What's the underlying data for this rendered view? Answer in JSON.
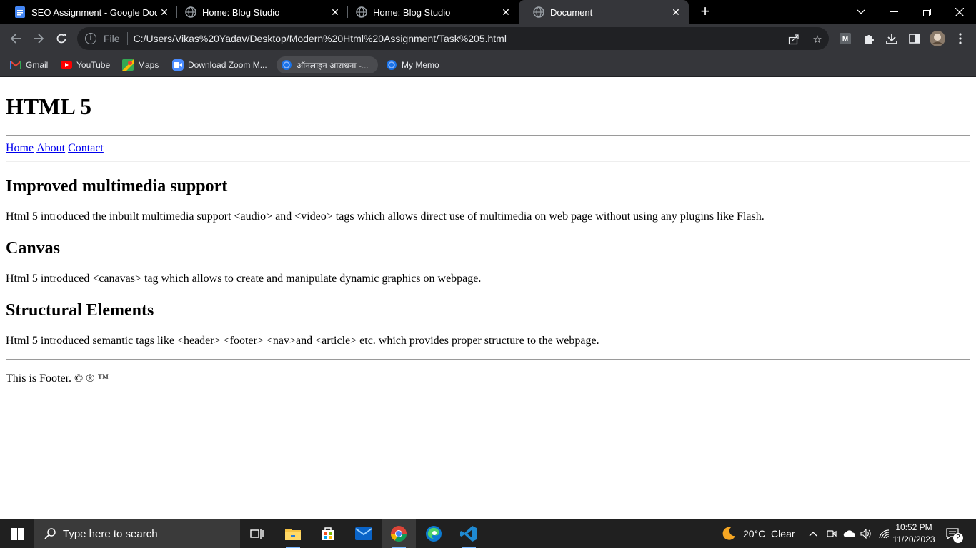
{
  "browser": {
    "tabs": [
      {
        "title": "SEO Assignment - Google Docs",
        "icon": "google-docs-icon"
      },
      {
        "title": "Home: Blog Studio",
        "icon": "globe-icon"
      },
      {
        "title": "Home: Blog Studio",
        "icon": "globe-icon"
      },
      {
        "title": "Document",
        "icon": "globe-icon",
        "active": true
      }
    ],
    "omnibox": {
      "scheme_label": "File",
      "url": "C:/Users/Vikas%20Yadav/Desktop/Modern%20Html%20Assignment/Task%205.html"
    },
    "bookmarks": [
      {
        "label": "Gmail",
        "icon": "gmail-icon"
      },
      {
        "label": "YouTube",
        "icon": "youtube-icon"
      },
      {
        "label": "Maps",
        "icon": "maps-icon"
      },
      {
        "label": "Download Zoom M...",
        "icon": "zoom-icon"
      },
      {
        "label": "ऑनलाइन आराधना -...",
        "icon": "globe-icon"
      },
      {
        "label": "My Memo",
        "icon": "globe-icon"
      }
    ]
  },
  "page": {
    "title": "HTML 5",
    "nav": [
      "Home",
      "About",
      "Contact"
    ],
    "sections": [
      {
        "heading": "Improved multimedia support",
        "text": "Html 5 introduced the inbuilt multimedia support <audio> and <video> tags which allows direct use of multimedia on web page without using any plugins like Flash."
      },
      {
        "heading": "Canvas",
        "text": "Html 5 introduced <canavas> tag which allows to create and manipulate dynamic graphics on webpage."
      },
      {
        "heading": "Structural Elements",
        "text": "Html 5 introduced semantic tags like <header> <footer> <nav>and <article> etc. which provides proper structure to the webpage."
      }
    ],
    "footer": "This is Footer. © ® ™"
  },
  "taskbar": {
    "search_placeholder": "Type here to search",
    "weather": "20°C  Clear",
    "time": "10:52 PM",
    "date": "11/20/2023",
    "notification_count": "2"
  },
  "colors": {
    "tabstrip": "#000000",
    "toolbar": "#35363a",
    "link": "#0000ee",
    "taskbar": "#202020"
  }
}
